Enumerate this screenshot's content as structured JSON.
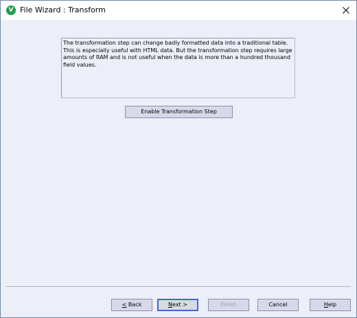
{
  "window": {
    "title": "File Wizard : Transform",
    "app_icon_letter": "V",
    "app_icon_color": "#1f9c4a"
  },
  "info": {
    "text": "The transformation step can change badly formatted data into a traditional table.\nThis is especially useful with HTML data. But the transformation step requires large\namounts of RAM and is not useful when the data is more than a hundred thousand\nfield values."
  },
  "buttons": {
    "enable_transformation": "Enable Transformation Step",
    "back_mnemonic": "<",
    "back_rest": " Back",
    "next_mnemonic": "N",
    "next_rest": "ext >",
    "finish": "Finish",
    "cancel": "Cancel",
    "help_mnemonic": "H",
    "help_rest": "elp"
  },
  "states": {
    "finish_enabled": false,
    "default_button": "Next"
  }
}
